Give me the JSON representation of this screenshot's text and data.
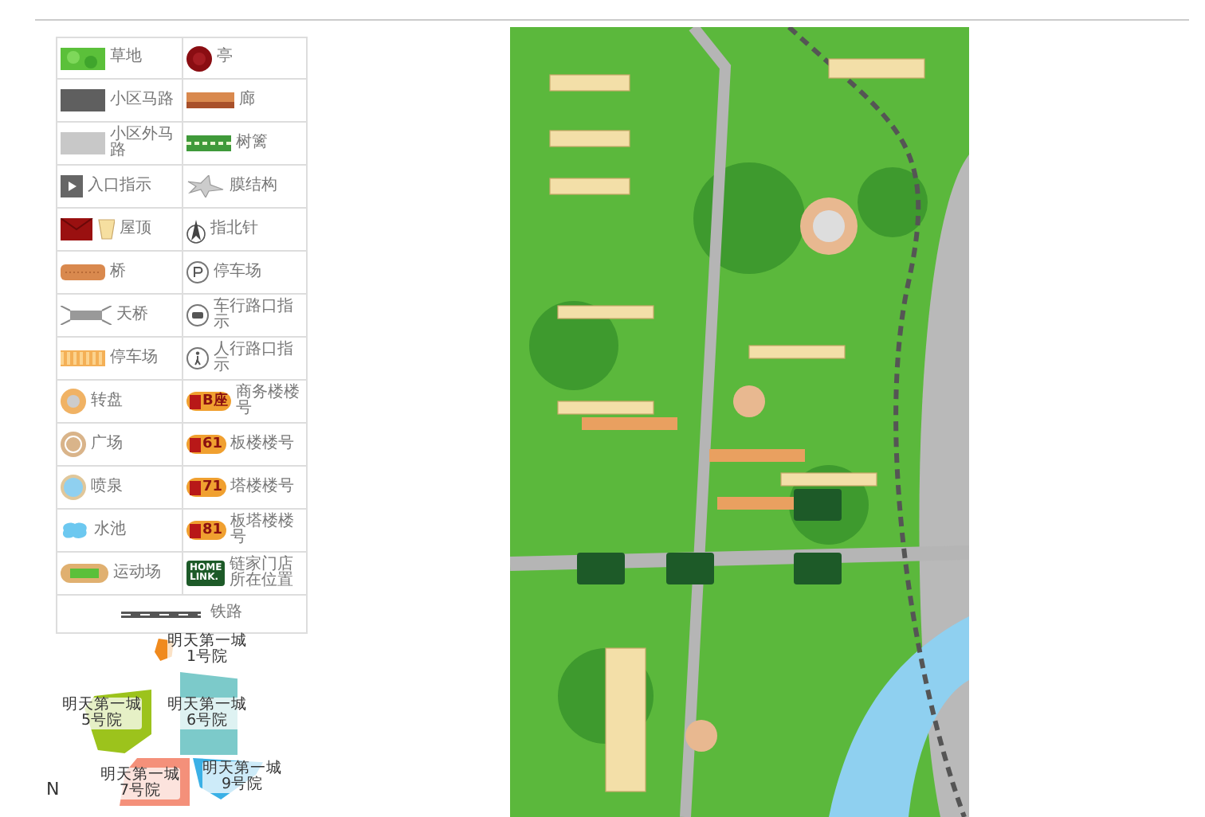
{
  "legend": {
    "rows": [
      {
        "left": {
          "kind": "grass",
          "label": "草地"
        },
        "right": {
          "kind": "pavilion",
          "label": "亭"
        }
      },
      {
        "left": {
          "kind": "inner-road",
          "label": "小区马路"
        },
        "right": {
          "kind": "corridor",
          "label": "廊"
        }
      },
      {
        "left": {
          "kind": "outer-road",
          "label": "小区外马路"
        },
        "right": {
          "kind": "hedge",
          "label": "树篱"
        }
      },
      {
        "left": {
          "kind": "entrance",
          "label": "入口指示"
        },
        "right": {
          "kind": "membrane",
          "label": "膜结构"
        }
      },
      {
        "left": {
          "kind": "roof",
          "label": "屋顶"
        },
        "right": {
          "kind": "compass",
          "label": "指北针"
        }
      },
      {
        "left": {
          "kind": "bridge",
          "label": "桥"
        },
        "right": {
          "kind": "parking",
          "label": "停车场"
        }
      },
      {
        "left": {
          "kind": "overpass",
          "label": "天桥"
        },
        "right": {
          "kind": "car-crossing",
          "label": "车行路口指示"
        }
      },
      {
        "left": {
          "kind": "parking-lot",
          "label": "停车场"
        },
        "right": {
          "kind": "walk-crossing",
          "label": "人行路口指示"
        }
      },
      {
        "left": {
          "kind": "roundabout",
          "label": "转盘"
        },
        "right": {
          "kind": "building-tag",
          "tag": "B座",
          "label": "商务楼楼号"
        }
      },
      {
        "left": {
          "kind": "plaza",
          "label": "广场"
        },
        "right": {
          "kind": "building-tag",
          "tag": "61",
          "label": "板楼楼号"
        }
      },
      {
        "left": {
          "kind": "fountain",
          "label": "喷泉"
        },
        "right": {
          "kind": "building-tag",
          "tag": "71",
          "label": "塔楼楼号"
        }
      },
      {
        "left": {
          "kind": "pool",
          "label": "水池"
        },
        "right": {
          "kind": "building-tag",
          "tag": "81",
          "label": "板塔楼楼号"
        }
      },
      {
        "left": {
          "kind": "sports-field",
          "label": "运动场"
        },
        "right": {
          "kind": "store",
          "logo_top": "HOME",
          "logo_bottom": "LINK.",
          "label": "链家门店所在位置"
        }
      }
    ],
    "railway": {
      "label": "铁路"
    }
  },
  "districts": [
    {
      "name": "明天第一城",
      "number": "1号院",
      "color": "#f08a1e"
    },
    {
      "name": "明天第一城",
      "number": "5号院",
      "color": "#9cc31c"
    },
    {
      "name": "明天第一城",
      "number": "6号院",
      "color": "#7ccaca"
    },
    {
      "name": "明天第一城",
      "number": "7号院",
      "color": "#f4907a"
    },
    {
      "name": "明天第一城",
      "number": "9号院",
      "color": "#3ab0e6"
    }
  ],
  "north_label": "N"
}
